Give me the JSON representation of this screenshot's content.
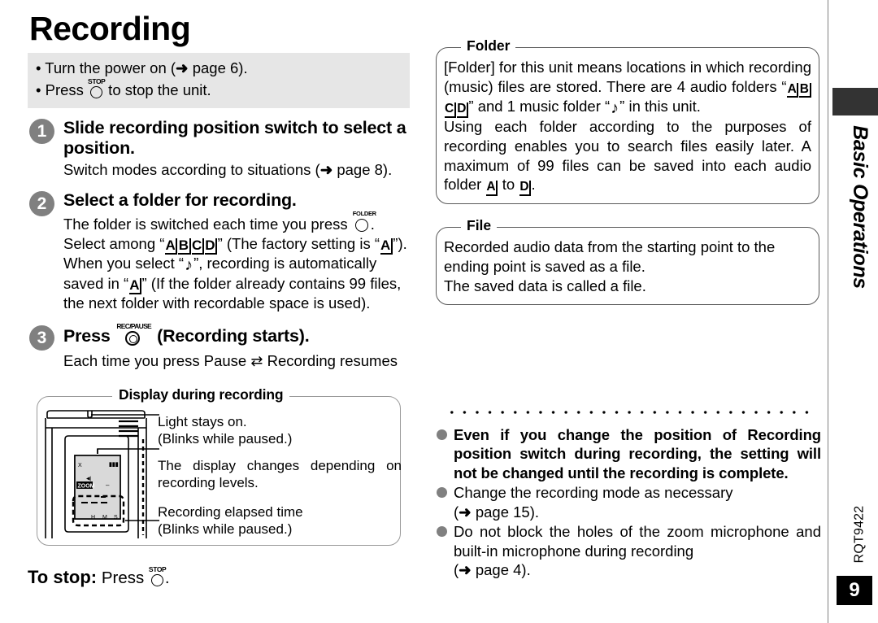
{
  "page": {
    "title": "Recording",
    "section_label": "Basic Operations",
    "doc_code": "RQT9422",
    "page_number": "9"
  },
  "prerequisites": {
    "line1_pre": "• Turn the power on (",
    "line1_arrow": "➜",
    "line1_post": " page 6).",
    "line2_pre": "• Press ",
    "line2_button": "STOP",
    "line2_post": " to stop the unit."
  },
  "steps": [
    {
      "number": "1",
      "title": "Slide recording position switch to select a position.",
      "body_pre": "Switch modes according to situations (",
      "body_arrow": "➜",
      "body_post": " page 8)."
    },
    {
      "number": "2",
      "title": "Select a folder for recording.",
      "line1_pre": "The folder is switched each time you press ",
      "line1_button": "FOLDER",
      "line1_post": ".",
      "line2_pre": "Select among “",
      "line2_folders": "A B C D",
      "line2_mid": "” (The factory setting is “",
      "line2_folder_a": "A",
      "line2_post": "”).",
      "line3_pre": "When you select “",
      "line3_note": "♪",
      "line3_mid": "”, recording is automatically saved in “",
      "line3_folder_a": "A",
      "line3_post": "” (If the folder already contains 99 files, the next folder with recordable space is used)."
    },
    {
      "number": "3",
      "title_pre": "Press ",
      "title_button": "REC/PAUSE",
      "title_post": " (Recording starts).",
      "body_pre": "Each time you press   Pause ",
      "body_swap": "⇄",
      "body_post": " Recording resumes"
    }
  ],
  "display_panel": {
    "legend": "Display during recording",
    "callout_light_line1": "Light stays on.",
    "callout_light_line2": "(Blinks while paused.)",
    "callout_display": "The display changes depending on recording levels.",
    "callout_elapsed_line1": "Recording elapsed time",
    "callout_elapsed_line2": "(Blinks while paused.)",
    "lcd": {
      "mode_mark": "X",
      "battery": "▮▮▮",
      "zoom_label": "ZOOM",
      "mic_mark": "◀|",
      "dash": "–",
      "unit_h": "H",
      "unit_m": "M",
      "unit_s": "S"
    }
  },
  "to_stop": {
    "bold": "To stop:",
    "pre": " Press ",
    "button": "STOP",
    "post": "."
  },
  "folder_box": {
    "legend": "Folder",
    "p1_a": "[Folder] for this unit means locations in which recording (music) files are stored. There are 4 audio folders “",
    "p1_folders": "A B C D",
    "p1_b": "” and 1 music folder “",
    "p1_note": "♪",
    "p1_c": "” in this unit.",
    "p2_a": "Using each folder according to the purposes of recording enables you to search files easily later. A maximum of 99 files can be saved into each audio folder ",
    "p2_folder_a": "A",
    "p2_b": " to ",
    "p2_folder_d": "D",
    "p2_c": "."
  },
  "file_box": {
    "legend": "File",
    "p1": "Recorded audio data from the starting point to the ending point is saved as a file.",
    "p2": "The saved data is called a file."
  },
  "notes": [
    {
      "bold": true,
      "text": "Even if you change the position of Recording position switch during recording, the setting will not be changed until the recording is complete."
    },
    {
      "bold": false,
      "text": "Change the recording mode as necessary",
      "tail_pre": "(",
      "tail_arrow": "➜",
      "tail_post": " page 15)."
    },
    {
      "bold": false,
      "text": "Do not block the holes of the zoom microphone and built-in microphone during recording",
      "tail_pre": "(",
      "tail_arrow": "➜",
      "tail_post": " page 4)."
    }
  ],
  "colors": {
    "grey_box": "#e6e6e6",
    "badge_grey": "#808080",
    "tab_black": "#333333",
    "page_num_bg": "#000000"
  }
}
